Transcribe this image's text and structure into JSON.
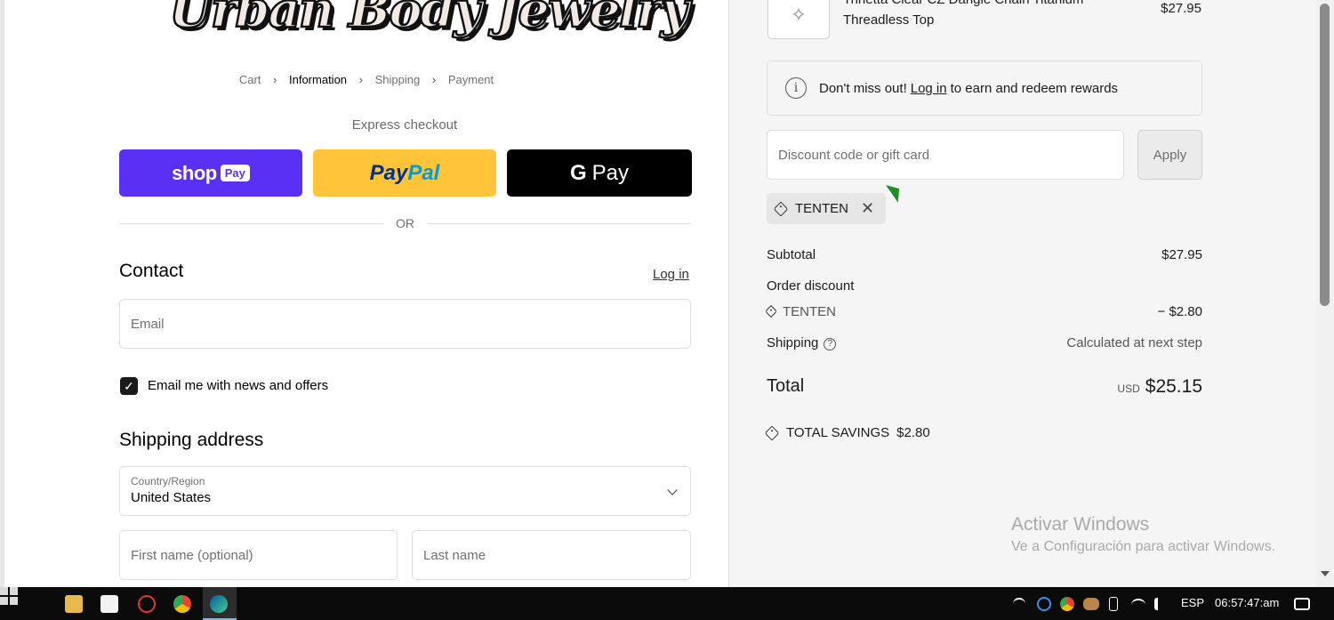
{
  "left": {
    "logo_text": "Urban Body Jewelry",
    "breadcrumb": {
      "cart": "Cart",
      "information": "Information",
      "shipping": "Shipping",
      "payment": "Payment",
      "separator": "›"
    },
    "express_checkout": "Express checkout",
    "shop_pay": {
      "shop": "shop",
      "pay": "Pay"
    },
    "paypal": {
      "pay": "Pay",
      "pal": "Pal"
    },
    "gpay": {
      "g": "G",
      "pay": "Pay"
    },
    "or_label": "OR",
    "contact": {
      "title": "Contact",
      "login_link": "Log in",
      "email_placeholder": "Email",
      "newsletter_label": "Email me with news and offers",
      "newsletter_checked": true
    },
    "shipping_address": {
      "title": "Shipping address",
      "country_label": "Country/Region",
      "country_value": "United States",
      "first_name_placeholder": "First name (optional)",
      "last_name_placeholder": "Last name"
    }
  },
  "right": {
    "product": {
      "name": "Trinetta Clear CZ Dangle Chain Titanium Threadless Top",
      "price": "$27.95"
    },
    "rewards": {
      "prefix": "Don't miss out!",
      "link": "Log in",
      "suffix": "to earn and redeem rewards"
    },
    "discount": {
      "placeholder": "Discount code or gift card",
      "apply_label": "Apply",
      "applied_code": "TENTEN",
      "remove_symbol": "✕"
    },
    "summary": {
      "subtotal_label": "Subtotal",
      "subtotal_value": "$27.95",
      "order_discount_label": "Order discount",
      "discount_code": "TENTEN",
      "discount_value": "− $2.80",
      "shipping_label": "Shipping",
      "shipping_help": "?",
      "shipping_value": "Calculated at next step",
      "total_label": "Total",
      "total_currency": "USD",
      "total_value": "$25.15",
      "savings_label": "TOTAL SAVINGS",
      "savings_value": "$2.80"
    },
    "watermark": {
      "title": "Activar Windows",
      "subtitle": "Ve a Configuración para activar Windows."
    }
  },
  "taskbar": {
    "language": "ESP",
    "time": "06:57:47:am",
    "accent": "#76b9ed"
  },
  "colors": {
    "shop_pay": "#5a31f4",
    "paypal": "#ffc439",
    "gpay": "#000000",
    "summary_bg": "#f5f5f5"
  }
}
